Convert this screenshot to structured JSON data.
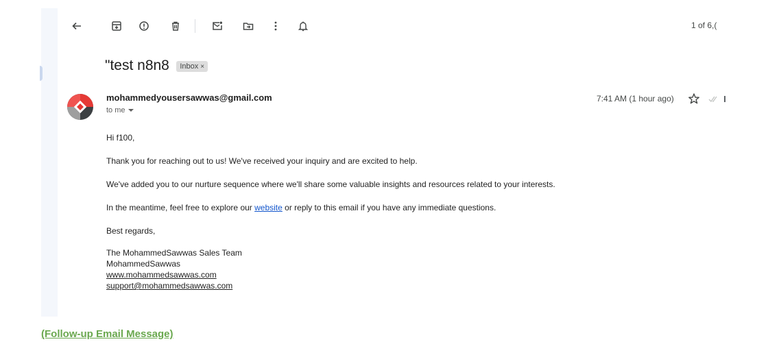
{
  "toolbar": {
    "icons": [
      "back-arrow-icon",
      "archive-icon",
      "report-spam-icon",
      "delete-icon",
      "mark-unread-icon",
      "move-to-icon",
      "more-options-icon",
      "snooze-icon"
    ],
    "pager_text": "1 of 6,("
  },
  "message": {
    "subject": "\"test n8n8",
    "label": "Inbox",
    "label_close": "×",
    "sender_email": "mohammedyousersawwas@gmail.com",
    "recipient": "to me",
    "timestamp": "7:41 AM (1 hour ago)"
  },
  "body": {
    "greeting": "Hi f100,",
    "paragraph_1": "Thank you for reaching out to us! We've received your inquiry and are excited to help.",
    "paragraph_2": "We've added you to our nurture sequence where we'll share some valuable insights and resources related to your interests.",
    "paragraph_3_before": "In the meantime, feel free to explore our ",
    "paragraph_3_link": "website",
    "paragraph_3_after": " or reply to this email if you have any immediate questions.",
    "closing": "Best regards,",
    "signature_team": "The MohammedSawwas Sales Team",
    "signature_company": "MohammedSawwas",
    "signature_website": "www.mohammedsawwas.com",
    "signature_email": "support@mohammedsawwas.com"
  },
  "caption": "(Follow-up Email Message)",
  "colors": {
    "caption_green": "#6aa84f",
    "link_blue": "#1155cc",
    "avatar_red": "#e53935",
    "avatar_dark": "#3c4043"
  }
}
